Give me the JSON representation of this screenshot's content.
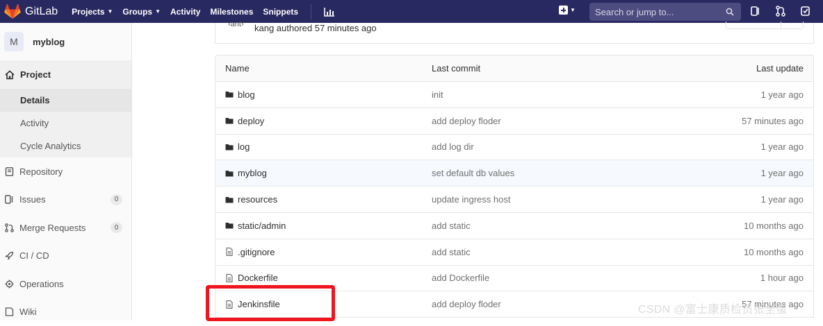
{
  "navbar": {
    "brand": "GitLab",
    "items": [
      {
        "label": "Projects",
        "caret": true
      },
      {
        "label": "Groups",
        "caret": true
      },
      {
        "label": "Activity",
        "caret": false
      },
      {
        "label": "Milestones",
        "caret": false
      },
      {
        "label": "Snippets",
        "caret": false
      }
    ],
    "search_placeholder": "Search or jump to...",
    "colors": {
      "bg": "#292961",
      "search_bg": "#4c4c80"
    }
  },
  "sidebar": {
    "avatar": "M",
    "project_name": "myblog",
    "project_section": "Project",
    "sub_items": [
      "Details",
      "Activity",
      "Cycle Analytics"
    ],
    "items": [
      {
        "label": "Repository",
        "icon": "repository-icon",
        "badge": ""
      },
      {
        "label": "Issues",
        "icon": "issues-icon",
        "badge": "0"
      },
      {
        "label": "Merge Requests",
        "icon": "merge-request-icon",
        "badge": "0"
      },
      {
        "label": "CI / CD",
        "icon": "rocket-icon",
        "badge": ""
      },
      {
        "label": "Operations",
        "icon": "operations-icon",
        "badge": ""
      },
      {
        "label": "Wiki",
        "icon": "wiki-icon",
        "badge": ""
      }
    ]
  },
  "commit": {
    "ant": "ant",
    "author_text": "kang authored 57 minutes ago"
  },
  "tree": {
    "headers": {
      "name": "Name",
      "last_commit": "Last commit",
      "last_update": "Last update"
    },
    "rows": [
      {
        "name": "blog",
        "type": "folder",
        "commit": "init",
        "update": "1 year ago"
      },
      {
        "name": "deploy",
        "type": "folder",
        "commit": "add deploy floder",
        "update": "57 minutes ago"
      },
      {
        "name": "log",
        "type": "folder",
        "commit": "add log dir",
        "update": "1 year ago"
      },
      {
        "name": "myblog",
        "type": "folder",
        "commit": "set default db values",
        "update": "1 year ago"
      },
      {
        "name": "resources",
        "type": "folder",
        "commit": "update ingress host",
        "update": "1 year ago"
      },
      {
        "name": "static/admin",
        "type": "folder",
        "commit": "add static",
        "update": "10 months ago"
      },
      {
        "name": ".gitignore",
        "type": "file",
        "commit": "add static",
        "update": "10 months ago"
      },
      {
        "name": "Dockerfile",
        "type": "file",
        "commit": "add Dockerfile",
        "update": "1 hour ago"
      },
      {
        "name": "Jenkinsfile",
        "type": "file",
        "commit": "add deploy floder",
        "update": "57 minutes ago"
      }
    ]
  },
  "watermark": "CSDN @富士康质检员张全蛋",
  "highlight_color": "#f0141e"
}
